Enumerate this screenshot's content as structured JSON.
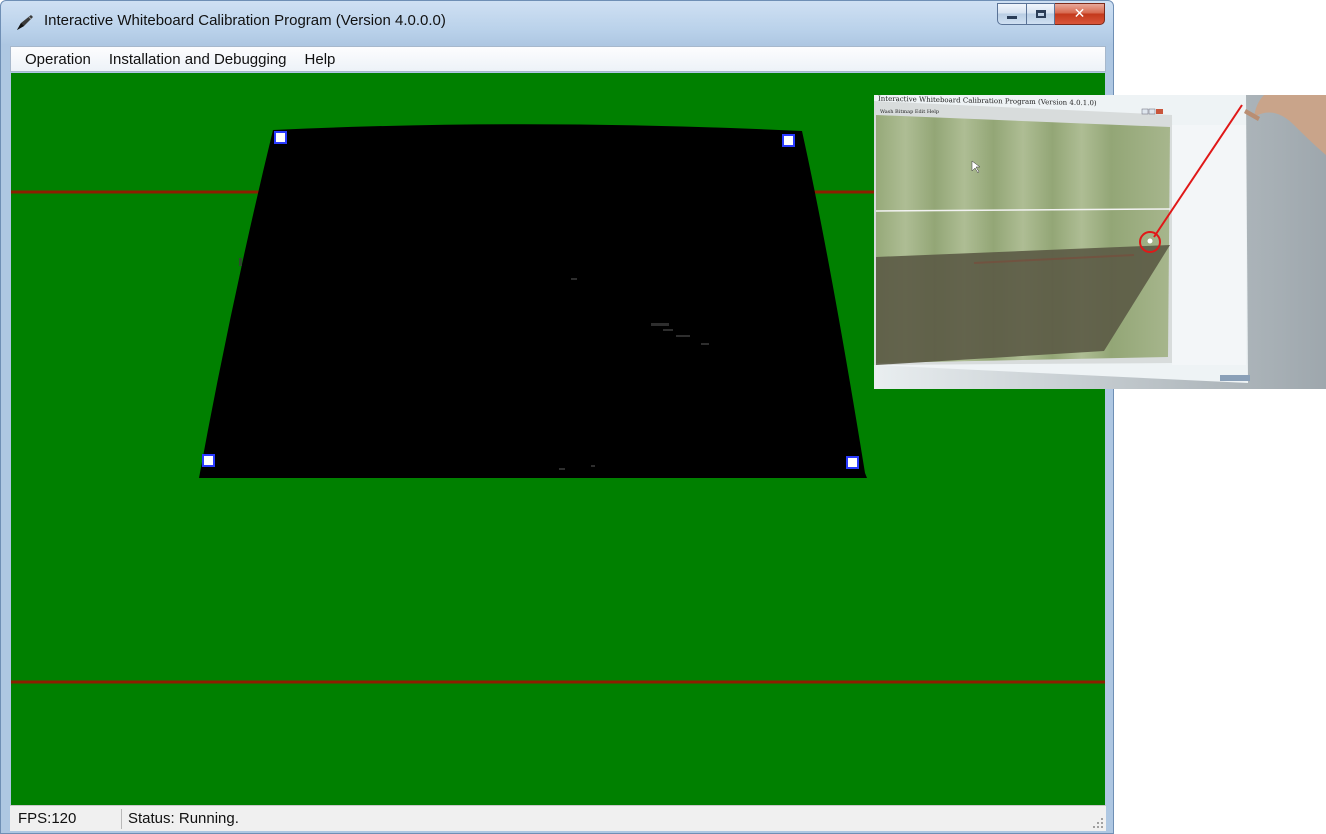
{
  "window": {
    "title": "Interactive Whiteboard Calibration Program (Version 4.0.0.0)"
  },
  "menu": [
    {
      "label": "Operation"
    },
    {
      "label": "Installation and Debugging"
    },
    {
      "label": "Help"
    }
  ],
  "status": {
    "fps": "FPS:120",
    "text": "Status: Running."
  },
  "colors": {
    "canvas": "#008000",
    "guide_line": "#8b1f00",
    "marker_fill": "#ffffff",
    "marker_border": "#2a3bff",
    "highlight_circle": "#e01818"
  },
  "photo": {
    "title": "Interactive Whiteboard Calibration Program (Version 4.0.1.0)",
    "menu": "Wash Bitmap Edit  Help"
  }
}
